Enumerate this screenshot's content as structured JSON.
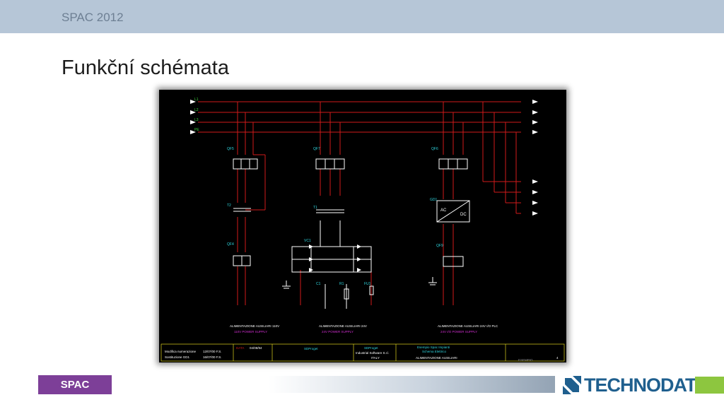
{
  "header": {
    "event": "SPAC 2012"
  },
  "slide": {
    "title": "Funkční schémata"
  },
  "schematic": {
    "phases": [
      "L1",
      "L2",
      "L3",
      "PE"
    ],
    "left_breaker": "QF5",
    "mid_breaker": "QF7",
    "right_breaker": "QF6",
    "lower_left_breaker": "QF4",
    "lower_right_breaker": "QF9",
    "transformer": "T2",
    "mid_transformer": "T1",
    "rectifier": "VC1",
    "converter": "GD1",
    "converter_ac": "AC",
    "converter_dc": "DC",
    "capacitor": "C1",
    "resistor": "R1",
    "fuse": "FU1",
    "left_caption": "ALIMENTAZIONE AUSILIARI 110V",
    "left_caption_2": "110V POWER SUPPLY",
    "mid_caption": "ALIMENTAZIONE AUSILIARI 24V",
    "mid_caption_2": "24V POWER SUPPLY",
    "right_caption": "ALIMENTAZIONE AUSILIARI 24V I/O PLC",
    "right_caption_2": "24V I/O POWER SUPPLY",
    "title_block": {
      "rev1": "Modifica numerazione",
      "rev1_date": "12/07/00 F.S.",
      "rev2": "Sostituzione GD1",
      "rev2_date": "16/07/00 F.S.",
      "date_label": "DATA",
      "date": "04/08/94",
      "company": "SDProget",
      "company_2": "SDProget",
      "address": "Industrial Software S.r.l.",
      "country": "ITALY",
      "project": "Esempio Spac Impianti",
      "drawing_type": "Schema Elettrico",
      "sheet_title": "ALIMENTAZIONE AUSILIARI",
      "sheet_code": "ESEMPIO",
      "sheet_no": "4"
    }
  },
  "footer": {
    "spac_logo": "SPAC",
    "company_logo": "TECHNODAT"
  },
  "colors": {
    "topbar": "#b6c6d7",
    "spac_purple": "#7d3f98",
    "technodat_blue": "#1f5f8e",
    "accent_green": "#8dc63f",
    "wire_red": "#d11a1a",
    "line_white": "#ffffff",
    "label_green": "#3dd13d",
    "label_cyan": "#2fd6e0",
    "label_magenta": "#d12ed1",
    "label_yellow": "#e0d41f"
  }
}
